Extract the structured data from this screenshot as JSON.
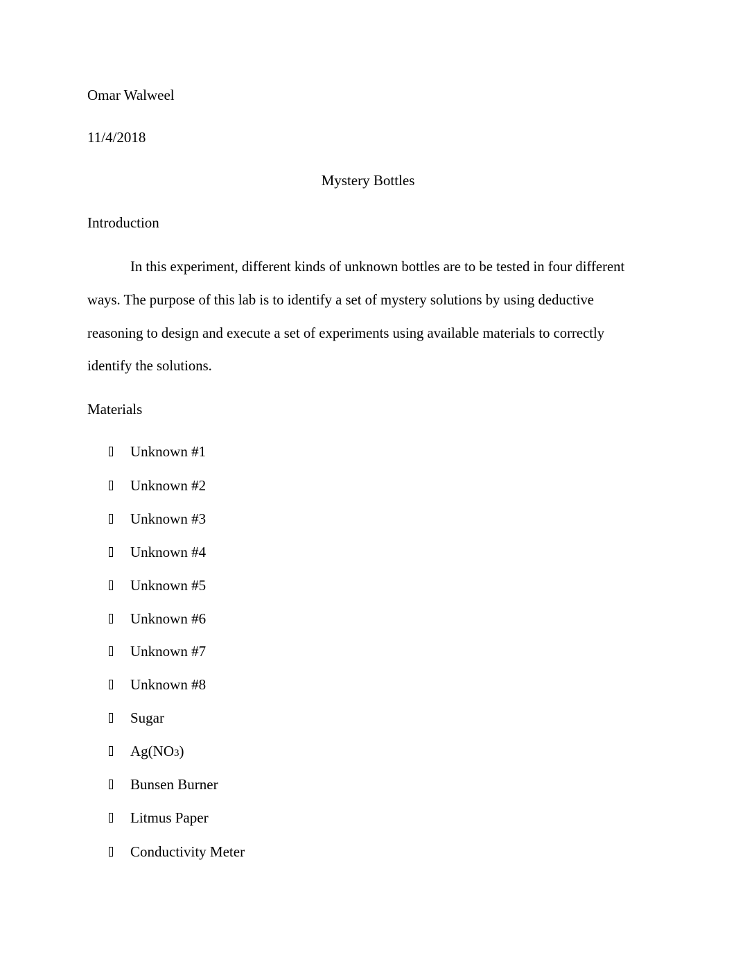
{
  "header": {
    "author": "Omar Walweel",
    "date": "11/4/2018",
    "title": "Mystery Bottles"
  },
  "introduction": {
    "heading": "Introduction",
    "lines": [
      "In this experiment, different kinds of unknown bottles are to be tested in four different",
      "ways. The purpose of this lab is to identify a set of mystery solutions by using deductive",
      "reasoning to design and execute a set of experiments using available materials to correctly",
      "identify the solutions."
    ]
  },
  "materials": {
    "heading": "Materials",
    "bullet_icon": "missing-glyph-box",
    "items": [
      {
        "label": "Unknown #1"
      },
      {
        "label": "Unknown #2"
      },
      {
        "label": "Unknown #3"
      },
      {
        "label": "Unknown #4"
      },
      {
        "label": "Unknown #5"
      },
      {
        "label": "Unknown #6"
      },
      {
        "label": "Unknown #7"
      },
      {
        "label": "Unknown #8"
      },
      {
        "label": "Sugar"
      },
      {
        "label": "Ag(NO",
        "subscript": "3",
        "suffix": ")"
      },
      {
        "label": "Bunsen Burner"
      },
      {
        "label": "Litmus Paper"
      },
      {
        "label": "Conductivity Meter"
      }
    ]
  }
}
